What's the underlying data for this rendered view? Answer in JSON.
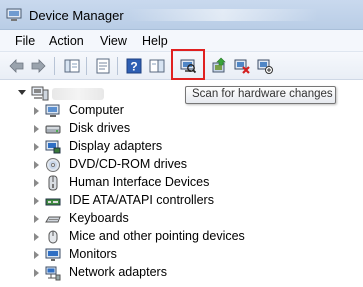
{
  "window": {
    "title": "Device Manager"
  },
  "menu": {
    "items": [
      "File",
      "Action",
      "View",
      "Help"
    ]
  },
  "toolbar": {
    "buttons": [
      "back-arrow-icon",
      "forward-arrow-icon",
      "show-hide-console-tree-icon",
      "properties-icon",
      "help-icon",
      "action-pane-icon",
      "scan-hardware-icon",
      "update-driver-icon",
      "uninstall-icon",
      "disable-icon"
    ]
  },
  "tooltip": {
    "text": "Scan for hardware changes"
  },
  "tree": {
    "root_expanded": true,
    "categories": [
      {
        "label": "Computer",
        "icon": "computer-icon"
      },
      {
        "label": "Disk drives",
        "icon": "disk-drive-icon"
      },
      {
        "label": "Display adapters",
        "icon": "display-adapter-icon"
      },
      {
        "label": "DVD/CD-ROM drives",
        "icon": "dvd-drive-icon"
      },
      {
        "label": "Human Interface Devices",
        "icon": "hid-icon"
      },
      {
        "label": "IDE ATA/ATAPI controllers",
        "icon": "ide-controller-icon"
      },
      {
        "label": "Keyboards",
        "icon": "keyboard-icon"
      },
      {
        "label": "Mice and other pointing devices",
        "icon": "mouse-icon"
      },
      {
        "label": "Monitors",
        "icon": "monitor-icon"
      },
      {
        "label": "Network adapters",
        "icon": "network-adapter-icon"
      }
    ]
  },
  "colors": {
    "highlight": "#e02020",
    "titlebar": "#c9d9ee"
  }
}
